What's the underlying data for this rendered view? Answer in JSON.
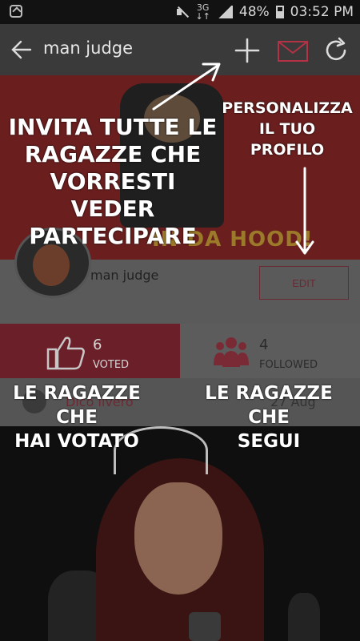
{
  "status_bar": {
    "network": "3G",
    "network_sub": "↓↑",
    "battery": "48%",
    "time": "03:52 PM"
  },
  "app_bar": {
    "title": "man judge"
  },
  "profile": {
    "name": "man judge",
    "edit_label": "EDIT"
  },
  "stats": {
    "voted_count": "6",
    "voted_label": "VOTED",
    "followed_count": "4",
    "followed_label": "FOLLOWED"
  },
  "feed": {
    "user_name": "Dico livero",
    "date": "27 Aug"
  },
  "overlay": {
    "invite_lines": [
      "INVITA TUTTE LE",
      "RAGAZZE CHE",
      "VORRESTI VEDER",
      "PARTECIPARE"
    ],
    "personalize_lines": [
      "PERSONALIZZA",
      "IL TUO",
      "PROFILO"
    ],
    "voted_hint_lines": [
      "LE RAGAZZE",
      "CHE",
      "HAI VOTATO"
    ],
    "follow_hint_lines": [
      "LE RAGAZZE",
      "CHE",
      "SEGUI"
    ]
  },
  "cover": {
    "banner_text": "IN DA HOOD!"
  },
  "colors": {
    "accent": "#e0384f",
    "overlay_dim": "#000000"
  }
}
